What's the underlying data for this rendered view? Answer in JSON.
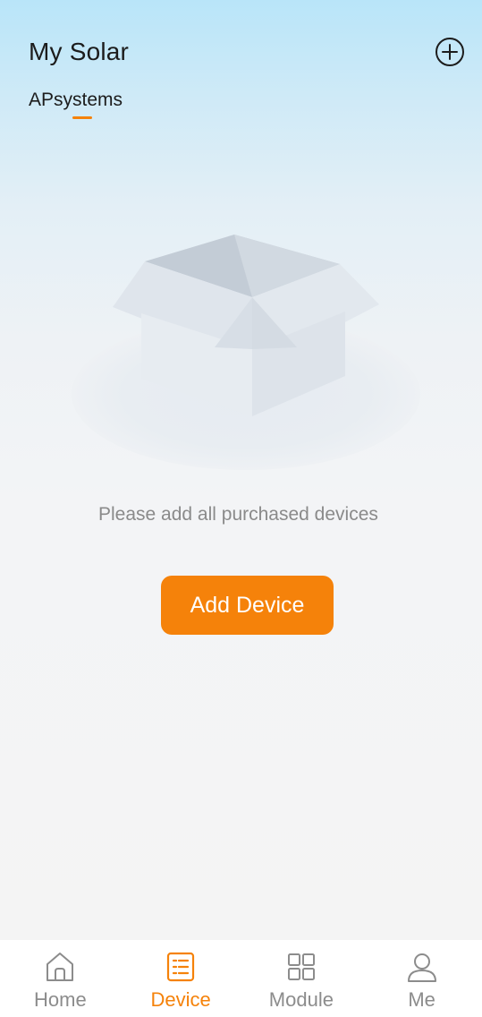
{
  "header": {
    "title": "My Solar",
    "add_icon": "plus-circle-icon",
    "tabs": [
      {
        "label": "APsystems",
        "active": true
      }
    ]
  },
  "empty_state": {
    "illustration": "empty-box-icon",
    "message": "Please add all purchased devices",
    "button_label": "Add Device"
  },
  "bottom_nav": {
    "items": [
      {
        "label": "Home",
        "icon": "home-icon",
        "active": false
      },
      {
        "label": "Device",
        "icon": "device-list-icon",
        "active": true
      },
      {
        "label": "Module",
        "icon": "module-grid-icon",
        "active": false
      },
      {
        "label": "Me",
        "icon": "user-icon",
        "active": false
      }
    ]
  },
  "colors": {
    "accent": "#f5820a",
    "text_primary": "#1c1c1c",
    "text_muted": "#8a8a8a",
    "nav_inactive": "#8c8c8c",
    "header_gradient_top": "#b9e5f9",
    "background": "#f4f4f4"
  }
}
